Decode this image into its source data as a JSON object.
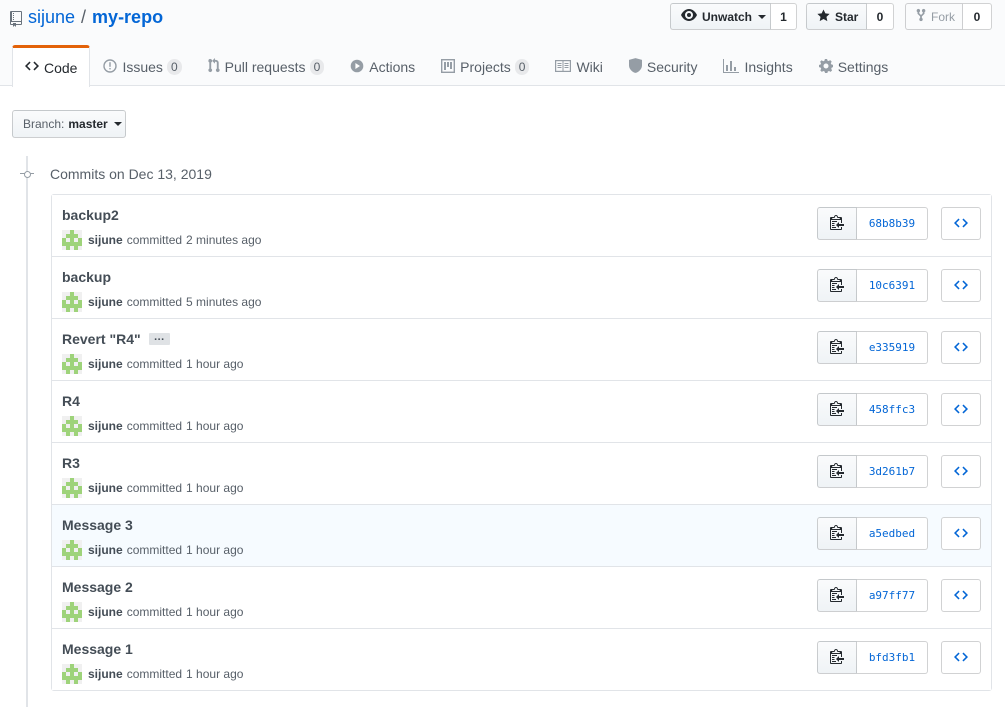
{
  "repo": {
    "owner": "sijune",
    "separator": "/",
    "name": "my-repo"
  },
  "actions": {
    "watch": {
      "label": "Unwatch",
      "count": "1"
    },
    "star": {
      "label": "Star",
      "count": "0"
    },
    "fork": {
      "label": "Fork",
      "count": "0"
    }
  },
  "tabs": [
    {
      "label": "Code",
      "selected": true
    },
    {
      "label": "Issues",
      "count": "0"
    },
    {
      "label": "Pull requests",
      "count": "0"
    },
    {
      "label": "Actions"
    },
    {
      "label": "Projects",
      "count": "0"
    },
    {
      "label": "Wiki"
    },
    {
      "label": "Security"
    },
    {
      "label": "Insights"
    },
    {
      "label": "Settings"
    }
  ],
  "branch": {
    "label": "Branch:",
    "name": "master"
  },
  "group_title": "Commits on Dec 13, 2019",
  "commits": [
    {
      "message": "backup2",
      "author": "sijune",
      "verb": "committed",
      "time": "2 minutes ago",
      "sha": "68b8b39"
    },
    {
      "message": "backup",
      "author": "sijune",
      "verb": "committed",
      "time": "5 minutes ago",
      "sha": "10c6391"
    },
    {
      "message": "Revert \"R4\"",
      "ellipsis": "…",
      "author": "sijune",
      "verb": "committed",
      "time": "1 hour ago",
      "sha": "e335919"
    },
    {
      "message": "R4",
      "author": "sijune",
      "verb": "committed",
      "time": "1 hour ago",
      "sha": "458ffc3"
    },
    {
      "message": "R3",
      "author": "sijune",
      "verb": "committed",
      "time": "1 hour ago",
      "sha": "3d261b7"
    },
    {
      "message": "Message 3",
      "author": "sijune",
      "verb": "committed",
      "time": "1 hour ago",
      "sha": "a5edbed",
      "highlighted": true
    },
    {
      "message": "Message 2",
      "author": "sijune",
      "verb": "committed",
      "time": "1 hour ago",
      "sha": "a97ff77"
    },
    {
      "message": "Message 1",
      "author": "sijune",
      "verb": "committed",
      "time": "1 hour ago",
      "sha": "bfd3fb1"
    }
  ],
  "colors": {
    "link": "#0366d6",
    "tab_accent": "#e36209",
    "avatar": "#9ed37a"
  }
}
